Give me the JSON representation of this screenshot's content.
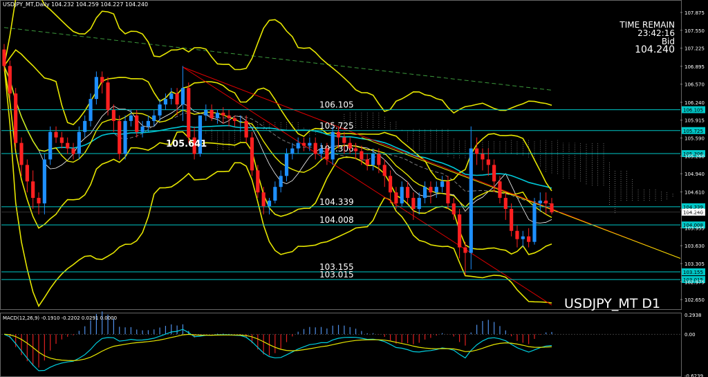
{
  "header": {
    "symbol_info": "USDJPY_MT,Daily  104.232 104.259 104.227 104.240",
    "macd_info": "MACD(12,26,9) -0.1910 -0.2202 0.0291 0.0000"
  },
  "timer": {
    "label": "TIME REMAIN",
    "time": "23:42:16",
    "bid_label": "Bid",
    "bid_value": "104.240"
  },
  "symbol_label": "USDJPY_MT D1",
  "annotation": {
    "value": "105.641"
  },
  "colors": {
    "background": "#000000",
    "bull": "#1e90ff",
    "bear": "#ff2020",
    "bollinger": "#e6e600",
    "ma_cyan": "#00c8d8",
    "trendline": "#e00000",
    "hline": "#00c8c8",
    "macd_hist_pos": "#4f8fe8",
    "macd_hist_neg": "#e02020",
    "macd_line": "#00d0e0",
    "signal_line": "#e6e600"
  },
  "chart_data": {
    "type": "candlestick",
    "y_axis": {
      "min": 102.5,
      "max": 108.0,
      "ticks": [
        "107.875",
        "107.550",
        "107.225",
        "106.895",
        "106.570",
        "106.240",
        "105.915",
        "105.590",
        "105.260",
        "104.940",
        "104.610",
        "104.285",
        "103.955",
        "103.630",
        "103.305",
        "102.975",
        "102.650"
      ]
    },
    "levels": [
      {
        "value": 106.105,
        "label": "106.105",
        "tag": "106.105"
      },
      {
        "value": 105.725,
        "label": "105.725",
        "tag": "105.725"
      },
      {
        "value": 105.306,
        "label": "105.306",
        "tag": "105.306"
      },
      {
        "value": 104.339,
        "label": "104.339",
        "tag": "104.339"
      },
      {
        "value": 104.008,
        "label": "104.008",
        "tag": "104.008"
      },
      {
        "value": 103.155,
        "label": "103.155",
        "tag": "103.155"
      },
      {
        "value": 103.015,
        "label": "103.015",
        "tag": "103.015"
      }
    ],
    "current_price": {
      "value": 104.24,
      "tag": "104.240"
    },
    "candles": [
      {
        "o": 107.2,
        "h": 107.3,
        "c": 106.9,
        "l": 106.8
      },
      {
        "o": 106.9,
        "h": 107.0,
        "c": 106.4,
        "l": 106.3
      },
      {
        "o": 106.4,
        "h": 106.5,
        "c": 105.5,
        "l": 105.4
      },
      {
        "o": 105.5,
        "h": 105.6,
        "c": 105.1,
        "l": 104.9
      },
      {
        "o": 105.1,
        "h": 105.2,
        "c": 104.8,
        "l": 104.6
      },
      {
        "o": 104.8,
        "h": 105.0,
        "c": 104.5,
        "l": 104.3
      },
      {
        "o": 104.5,
        "h": 104.6,
        "c": 104.4,
        "l": 104.2
      },
      {
        "o": 104.4,
        "h": 105.3,
        "c": 105.2,
        "l": 104.2
      },
      {
        "o": 105.2,
        "h": 105.8,
        "c": 105.7,
        "l": 105.1
      },
      {
        "o": 105.7,
        "h": 105.8,
        "c": 105.6,
        "l": 105.5
      },
      {
        "o": 105.6,
        "h": 105.7,
        "c": 105.5,
        "l": 105.4
      },
      {
        "o": 105.5,
        "h": 105.6,
        "c": 105.4,
        "l": 105.3
      },
      {
        "o": 105.4,
        "h": 105.5,
        "c": 105.3,
        "l": 105.2
      },
      {
        "o": 105.3,
        "h": 105.8,
        "c": 105.7,
        "l": 105.2
      },
      {
        "o": 105.7,
        "h": 106.0,
        "c": 105.9,
        "l": 105.6
      },
      {
        "o": 105.9,
        "h": 106.4,
        "c": 106.3,
        "l": 105.8
      },
      {
        "o": 106.3,
        "h": 106.8,
        "c": 106.7,
        "l": 106.2
      },
      {
        "o": 106.7,
        "h": 106.8,
        "c": 106.6,
        "l": 106.4
      },
      {
        "o": 106.6,
        "h": 106.7,
        "c": 106.1,
        "l": 106.0
      },
      {
        "o": 106.1,
        "h": 106.2,
        "c": 105.9,
        "l": 105.7
      },
      {
        "o": 105.9,
        "h": 106.0,
        "c": 105.3,
        "l": 105.2
      },
      {
        "o": 105.3,
        "h": 106.0,
        "c": 105.9,
        "l": 105.2
      },
      {
        "o": 105.9,
        "h": 106.1,
        "c": 106.0,
        "l": 105.8
      },
      {
        "o": 106.0,
        "h": 106.1,
        "c": 105.7,
        "l": 105.6
      },
      {
        "o": 105.7,
        "h": 105.9,
        "c": 105.8,
        "l": 105.6
      },
      {
        "o": 105.8,
        "h": 106.0,
        "c": 105.9,
        "l": 105.7
      },
      {
        "o": 105.9,
        "h": 106.1,
        "c": 106.0,
        "l": 105.8
      },
      {
        "o": 106.0,
        "h": 106.3,
        "c": 106.2,
        "l": 105.9
      },
      {
        "o": 106.2,
        "h": 106.4,
        "c": 106.3,
        "l": 106.1
      },
      {
        "o": 106.3,
        "h": 106.5,
        "c": 106.4,
        "l": 106.2
      },
      {
        "o": 106.4,
        "h": 106.5,
        "c": 106.2,
        "l": 106.0
      },
      {
        "o": 106.2,
        "h": 106.9,
        "c": 106.5,
        "l": 105.9
      },
      {
        "o": 106.5,
        "h": 106.6,
        "c": 105.6,
        "l": 105.5
      },
      {
        "o": 105.6,
        "h": 105.8,
        "c": 105.3,
        "l": 105.2
      },
      {
        "o": 105.3,
        "h": 105.4,
        "c": 106.0,
        "l": 105.25
      },
      {
        "o": 106.0,
        "h": 106.2,
        "c": 106.1,
        "l": 105.9
      },
      {
        "o": 106.1,
        "h": 106.2,
        "c": 105.95,
        "l": 105.9
      },
      {
        "o": 105.95,
        "h": 106.1,
        "c": 106.05,
        "l": 105.85
      },
      {
        "o": 106.05,
        "h": 106.15,
        "c": 106.0,
        "l": 105.85
      },
      {
        "o": 106.0,
        "h": 106.1,
        "c": 105.95,
        "l": 105.8
      },
      {
        "o": 105.95,
        "h": 106.0,
        "c": 105.9,
        "l": 105.8
      },
      {
        "o": 105.9,
        "h": 106.0,
        "c": 105.9,
        "l": 105.7
      },
      {
        "o": 105.9,
        "h": 106.0,
        "c": 105.6,
        "l": 105.5
      },
      {
        "o": 105.6,
        "h": 105.7,
        "c": 105.0,
        "l": 104.9
      },
      {
        "o": 105.0,
        "h": 105.1,
        "c": 104.6,
        "l": 104.5
      },
      {
        "o": 104.6,
        "h": 104.7,
        "c": 104.35,
        "l": 104.2
      },
      {
        "o": 104.35,
        "h": 104.5,
        "c": 104.45,
        "l": 104.2
      },
      {
        "o": 104.45,
        "h": 104.8,
        "c": 104.7,
        "l": 104.4
      },
      {
        "o": 104.7,
        "h": 105.0,
        "c": 104.9,
        "l": 104.6
      },
      {
        "o": 104.9,
        "h": 105.4,
        "c": 105.3,
        "l": 104.8
      },
      {
        "o": 105.3,
        "h": 105.5,
        "c": 105.4,
        "l": 105.2
      },
      {
        "o": 105.4,
        "h": 105.6,
        "c": 105.5,
        "l": 105.3
      },
      {
        "o": 105.5,
        "h": 105.6,
        "c": 105.45,
        "l": 105.35
      },
      {
        "o": 105.45,
        "h": 105.6,
        "c": 105.5,
        "l": 105.35
      },
      {
        "o": 105.5,
        "h": 105.6,
        "c": 105.3,
        "l": 105.2
      },
      {
        "o": 105.3,
        "h": 105.5,
        "c": 105.4,
        "l": 105.2
      },
      {
        "o": 105.4,
        "h": 105.5,
        "c": 105.2,
        "l": 105.1
      },
      {
        "o": 105.2,
        "h": 105.8,
        "c": 105.7,
        "l": 105.1
      },
      {
        "o": 105.7,
        "h": 105.8,
        "c": 105.6,
        "l": 105.4
      },
      {
        "o": 105.6,
        "h": 105.7,
        "c": 105.5,
        "l": 105.3
      },
      {
        "o": 105.5,
        "h": 105.6,
        "c": 105.4,
        "l": 105.3
      },
      {
        "o": 105.4,
        "h": 105.5,
        "c": 105.35,
        "l": 105.2
      },
      {
        "o": 105.35,
        "h": 105.45,
        "c": 105.2,
        "l": 105.1
      },
      {
        "o": 105.2,
        "h": 105.3,
        "c": 105.1,
        "l": 105.0
      },
      {
        "o": 105.1,
        "h": 105.4,
        "c": 105.3,
        "l": 105.0
      },
      {
        "o": 105.3,
        "h": 105.4,
        "c": 105.1,
        "l": 104.95
      },
      {
        "o": 105.1,
        "h": 105.2,
        "c": 104.9,
        "l": 104.7
      },
      {
        "o": 104.9,
        "h": 105.0,
        "c": 104.6,
        "l": 104.4
      },
      {
        "o": 104.6,
        "h": 104.7,
        "c": 104.4,
        "l": 104.3
      },
      {
        "o": 104.4,
        "h": 104.8,
        "c": 104.7,
        "l": 104.35
      },
      {
        "o": 104.7,
        "h": 104.8,
        "c": 104.5,
        "l": 104.4
      },
      {
        "o": 104.5,
        "h": 104.6,
        "c": 104.3,
        "l": 104.1
      },
      {
        "o": 104.3,
        "h": 104.6,
        "c": 104.5,
        "l": 104.2
      },
      {
        "o": 104.5,
        "h": 104.8,
        "c": 104.7,
        "l": 104.4
      },
      {
        "o": 104.7,
        "h": 104.8,
        "c": 104.6,
        "l": 104.4
      },
      {
        "o": 104.6,
        "h": 104.8,
        "c": 104.7,
        "l": 104.5
      },
      {
        "o": 104.7,
        "h": 104.9,
        "c": 104.8,
        "l": 104.6
      },
      {
        "o": 104.8,
        "h": 104.9,
        "c": 104.4,
        "l": 104.3
      },
      {
        "o": 104.4,
        "h": 104.5,
        "c": 104.2,
        "l": 104.1
      },
      {
        "o": 104.2,
        "h": 104.3,
        "c": 103.6,
        "l": 103.4
      },
      {
        "o": 103.6,
        "h": 103.7,
        "c": 103.5,
        "l": 103.1
      },
      {
        "o": 103.5,
        "h": 105.8,
        "c": 105.4,
        "l": 103.2
      },
      {
        "o": 105.4,
        "h": 105.6,
        "c": 105.3,
        "l": 105.1
      },
      {
        "o": 105.3,
        "h": 105.4,
        "c": 105.2,
        "l": 105.0
      },
      {
        "o": 105.2,
        "h": 105.4,
        "c": 105.1,
        "l": 104.9
      },
      {
        "o": 105.1,
        "h": 105.2,
        "c": 104.8,
        "l": 104.6
      },
      {
        "o": 104.8,
        "h": 104.9,
        "c": 104.5,
        "l": 104.4
      },
      {
        "o": 104.5,
        "h": 104.6,
        "c": 104.3,
        "l": 104.1
      },
      {
        "o": 104.3,
        "h": 104.4,
        "c": 103.9,
        "l": 103.8
      },
      {
        "o": 103.9,
        "h": 104.0,
        "c": 103.75,
        "l": 103.6
      },
      {
        "o": 103.75,
        "h": 103.9,
        "c": 103.8,
        "l": 103.6
      },
      {
        "o": 103.8,
        "h": 103.95,
        "c": 103.7,
        "l": 103.6
      },
      {
        "o": 103.7,
        "h": 104.5,
        "c": 104.4,
        "l": 103.65
      },
      {
        "o": 104.4,
        "h": 104.6,
        "c": 104.45,
        "l": 104.25
      },
      {
        "o": 104.45,
        "h": 104.6,
        "c": 104.4,
        "l": 104.2
      },
      {
        "o": 104.4,
        "h": 104.5,
        "c": 104.24,
        "l": 104.2
      }
    ],
    "macd": {
      "y_axis": {
        "min": -0.6239,
        "max": 0.2938,
        "ticks": [
          "0.2938",
          "0.00",
          "-0.6239"
        ]
      }
    }
  }
}
